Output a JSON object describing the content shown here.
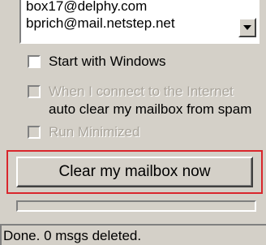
{
  "accounts_list": {
    "items": [
      "box17@delphy.com",
      "bprich@mail.netstep.net"
    ],
    "scroll_icon": "chevron-down-icon"
  },
  "options": {
    "start_with_windows": {
      "label": "Start with Windows",
      "checked": false,
      "enabled": true
    },
    "on_connect": {
      "label": "When I connect to the Internet",
      "label_line2": "auto clear my mailbox from spam",
      "checked": false,
      "enabled": false
    },
    "run_minimized": {
      "label": "Run Minimized",
      "checked": false,
      "enabled": false
    }
  },
  "actions": {
    "clear_button_label": "Clear my mailbox now"
  },
  "progress": {
    "value": 0
  },
  "status": {
    "text": "Done. 0 msgs deleted."
  },
  "colors": {
    "highlight": "#d9262c",
    "face": "#d4d0c8"
  }
}
